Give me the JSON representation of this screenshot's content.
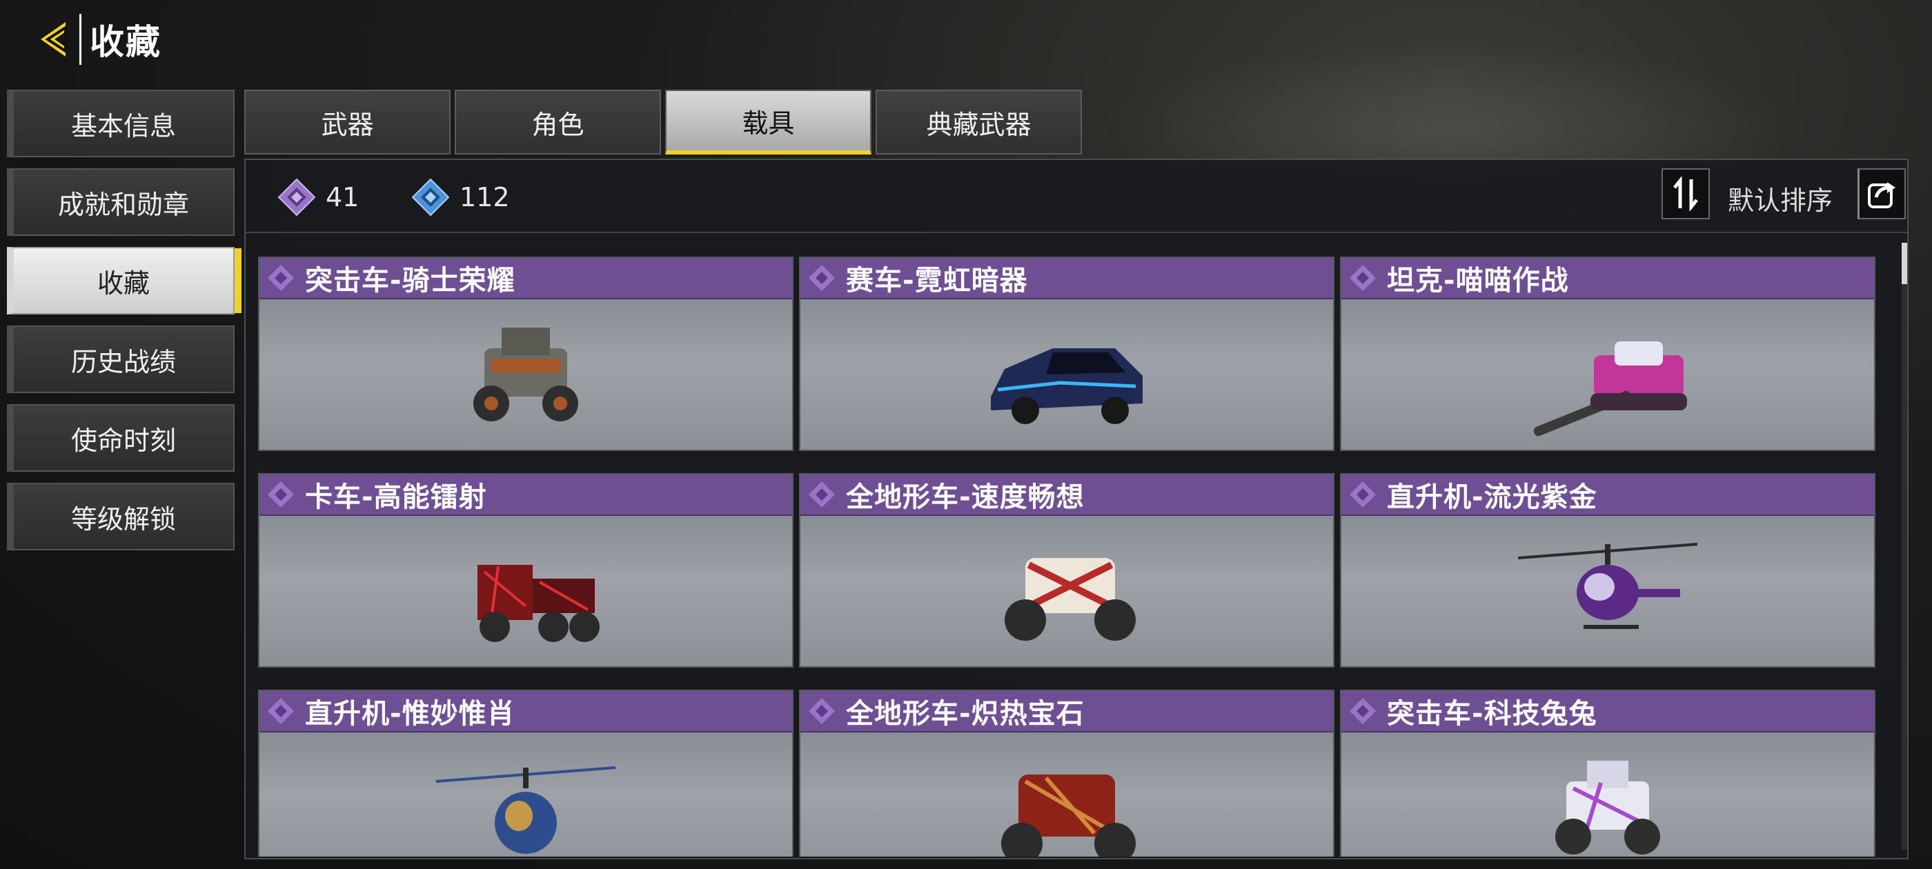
{
  "header": {
    "title": "收藏"
  },
  "left_nav": {
    "items": [
      {
        "label": "基本信息",
        "active": false
      },
      {
        "label": "成就和勋章",
        "active": false
      },
      {
        "label": "收藏",
        "active": true
      },
      {
        "label": "历史战绩",
        "active": false
      },
      {
        "label": "使命时刻",
        "active": false
      },
      {
        "label": "等级解锁",
        "active": false
      }
    ]
  },
  "tabs": [
    {
      "label": "武器",
      "active": false
    },
    {
      "label": "角色",
      "active": false
    },
    {
      "label": "载具",
      "active": true
    },
    {
      "label": "典藏武器",
      "active": false
    }
  ],
  "toolbar": {
    "currency_purple": {
      "icon": "purple-diamond-icon",
      "value": "41"
    },
    "currency_blue": {
      "icon": "blue-diamond-icon",
      "value": "112"
    },
    "sort_icon": "sort-arrows-icon",
    "sort_label": "默认排序",
    "share_icon": "share-icon"
  },
  "collection": {
    "items": [
      {
        "title": "突击车-骑士荣耀",
        "kind": "assault-vehicle",
        "colors": [
          "#6b6a63",
          "#a7562a"
        ]
      },
      {
        "title": "赛车-霓虹暗器",
        "kind": "race-car",
        "colors": [
          "#1f2a54",
          "#3cb6ff"
        ]
      },
      {
        "title": "坦克-喵喵作战",
        "kind": "tank",
        "colors": [
          "#c2359a",
          "#e6e6f5"
        ]
      },
      {
        "title": "卡车-高能镭射",
        "kind": "truck",
        "colors": [
          "#7a1518",
          "#3a2a2a"
        ]
      },
      {
        "title": "全地形车-速度畅想",
        "kind": "atv",
        "colors": [
          "#b72a2a",
          "#efe6da"
        ]
      },
      {
        "title": "直升机-流光紫金",
        "kind": "helicopter",
        "colors": [
          "#5a2a86",
          "#cfc5e6"
        ]
      },
      {
        "title": "直升机-惟妙惟肖",
        "kind": "helicopter",
        "colors": [
          "#2d4d8c",
          "#c49a4a"
        ]
      },
      {
        "title": "全地形车-炽热宝石",
        "kind": "atv",
        "colors": [
          "#8d2218",
          "#d08a3a"
        ]
      },
      {
        "title": "突击车-科技兔兔",
        "kind": "assault-vehicle",
        "colors": [
          "#e8e8f2",
          "#a64bc9"
        ]
      }
    ]
  },
  "colors": {
    "accent_yellow": "#f2d12a",
    "card_header_purple": "#6e4f93"
  }
}
